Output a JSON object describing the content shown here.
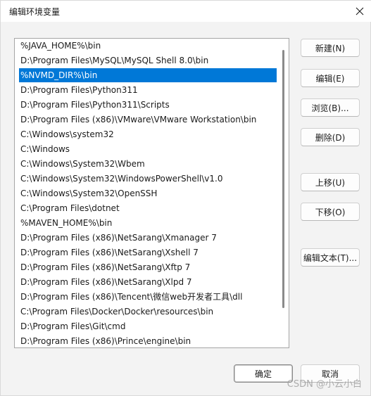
{
  "window": {
    "title": "编辑环境变量",
    "close_icon": "close-icon"
  },
  "list": {
    "selected_index": 2,
    "items": [
      "%JAVA_HOME%\\bin",
      "D:\\Program Files\\MySQL\\MySQL Shell 8.0\\bin",
      "%NVMD_DIR%\\bin",
      "D:\\Program Files\\Python311",
      "D:\\Program Files\\Python311\\Scripts",
      "D:\\Program Files (x86)\\VMware\\VMware Workstation\\bin",
      "C:\\Windows\\system32",
      "C:\\Windows",
      "C:\\Windows\\System32\\Wbem",
      "C:\\Windows\\System32\\WindowsPowerShell\\v1.0",
      "C:\\Windows\\System32\\OpenSSH",
      "C:\\Program Files\\dotnet",
      "%MAVEN_HOME%\\bin",
      "D:\\Program Files (x86)\\NetSarang\\Xmanager 7",
      "D:\\Program Files (x86)\\NetSarang\\Xshell 7",
      "D:\\Program Files (x86)\\NetSarang\\Xftp 7",
      "D:\\Program Files (x86)\\NetSarang\\Xlpd 7",
      "D:\\Program Files (x86)\\Tencent\\微信web开发者工具\\dll",
      "C:\\Program Files\\Docker\\Docker\\resources\\bin",
      "D:\\Program Files\\Git\\cmd",
      "D:\\Program Files (x86)\\Prince\\engine\\bin"
    ]
  },
  "buttons": {
    "new": "新建(N)",
    "edit": "编辑(E)",
    "browse": "浏览(B)...",
    "delete": "删除(D)",
    "move_up": "上移(U)",
    "move_down": "下移(O)",
    "edit_text": "编辑文本(T)...",
    "ok": "确定",
    "cancel": "取消"
  },
  "watermark": "CSDN @小云小白"
}
